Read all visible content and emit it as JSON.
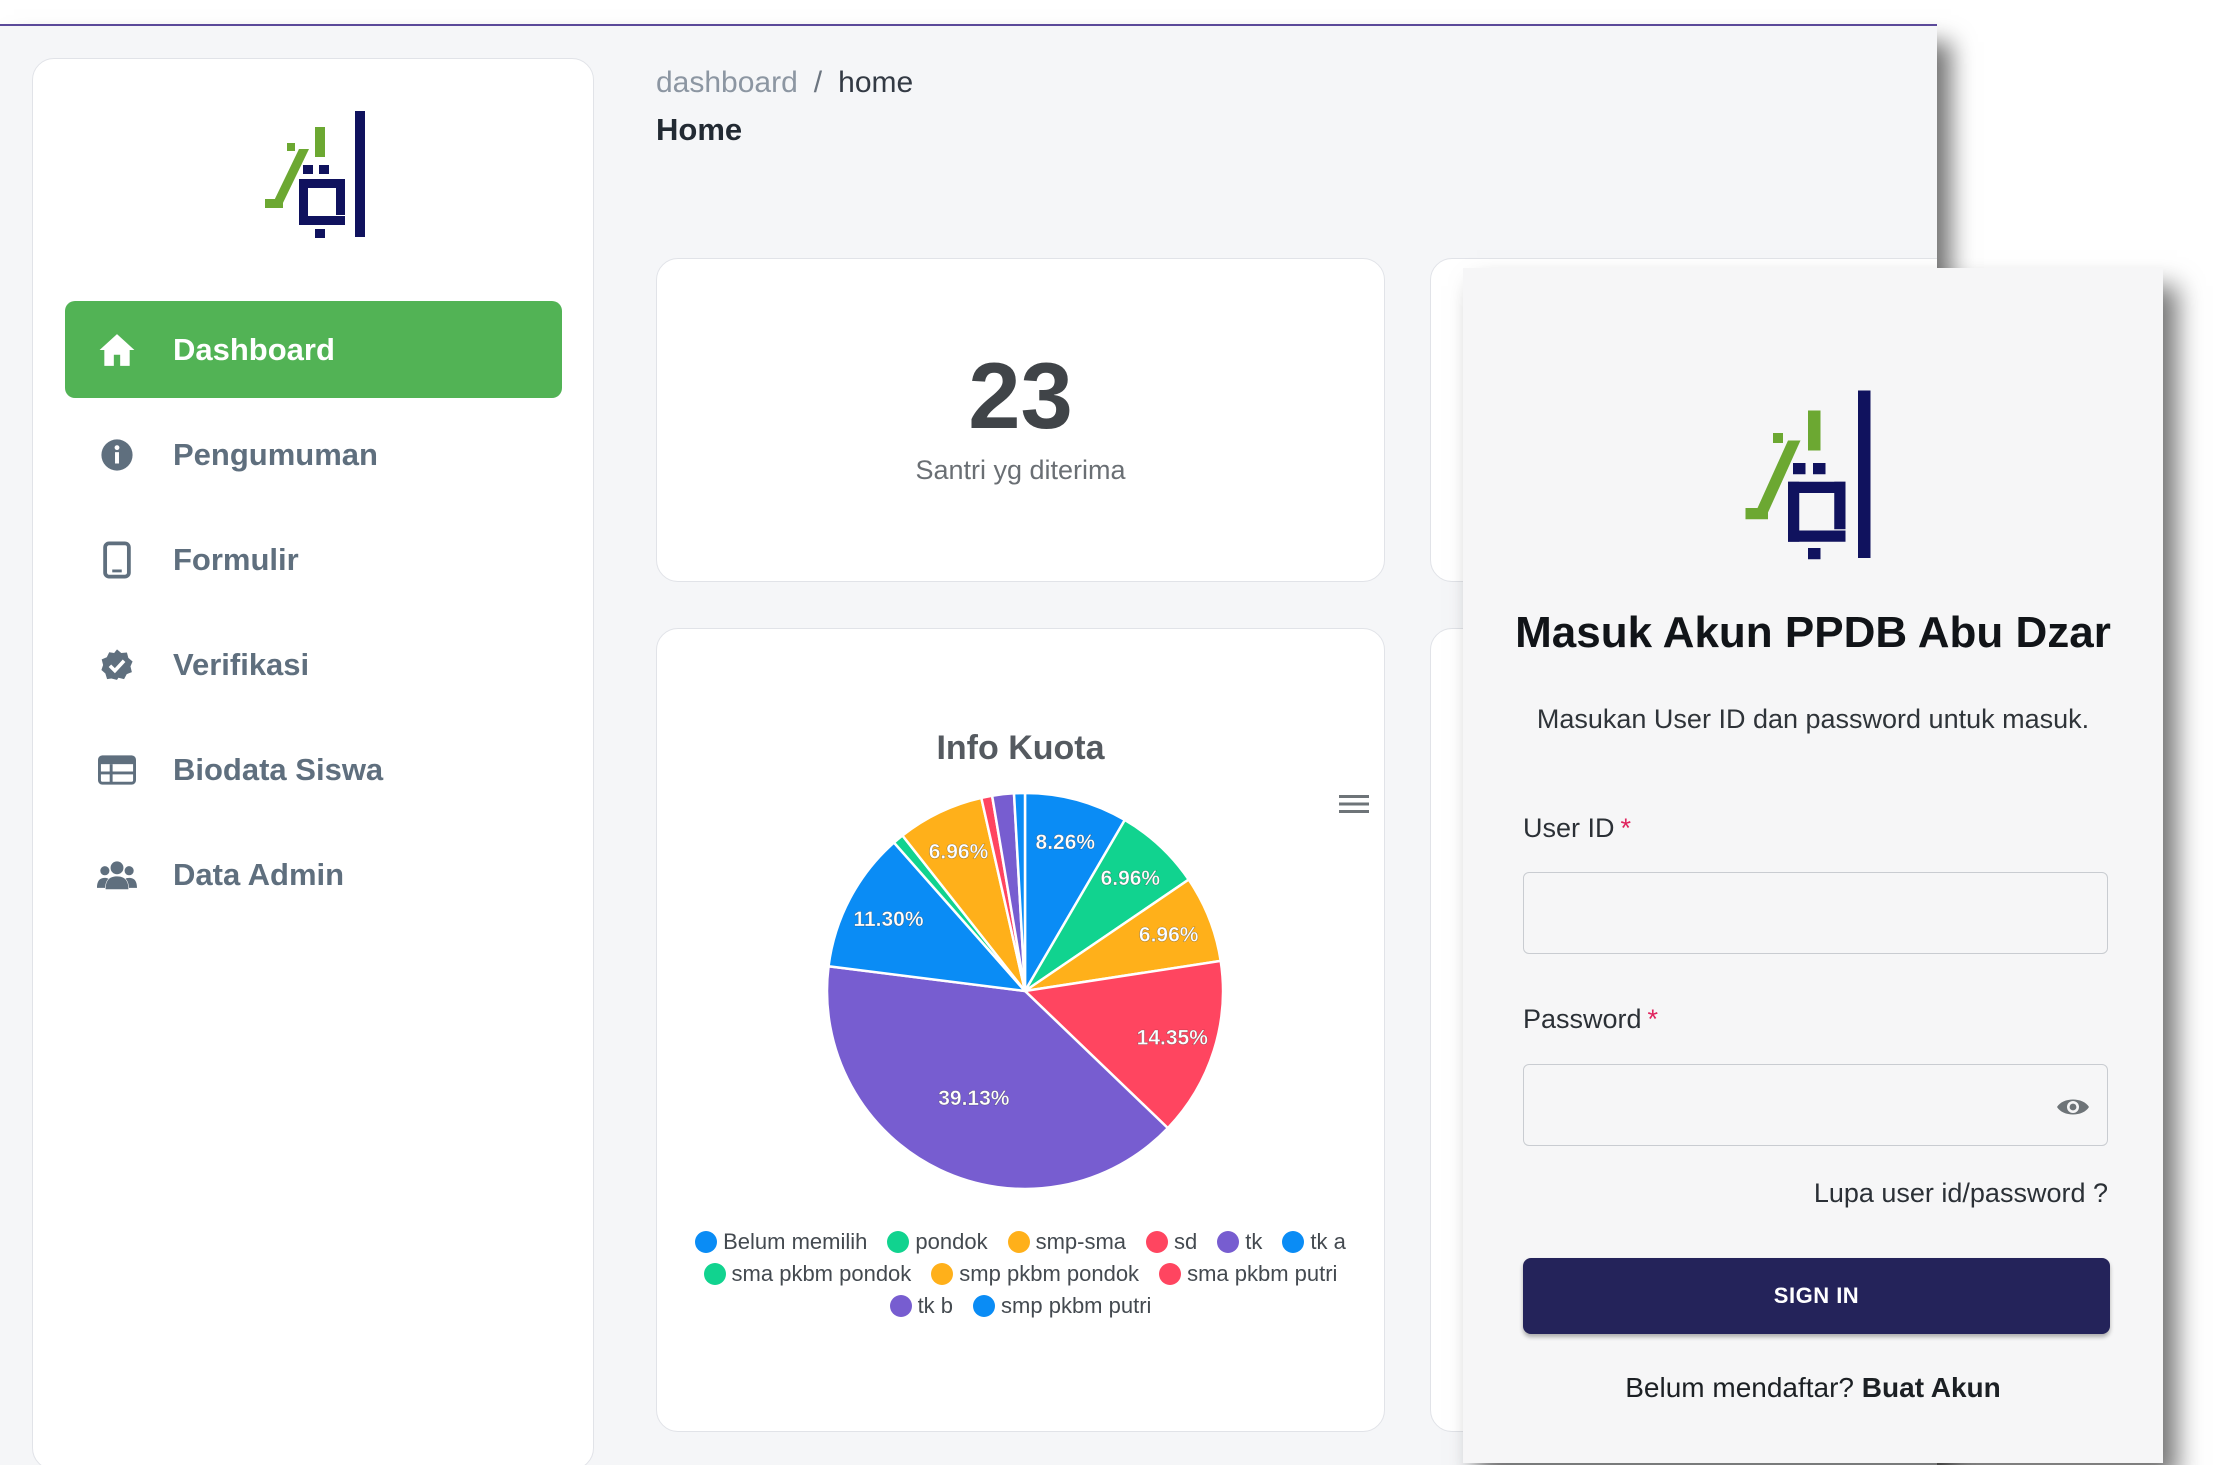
{
  "breadcrumb": {
    "parent": "dashboard",
    "separator": "/",
    "current": "home"
  },
  "page_title": "Home",
  "sidebar": {
    "items": [
      {
        "label": "Dashboard",
        "icon": "home-icon",
        "active": true
      },
      {
        "label": "Pengumuman",
        "icon": "info-icon",
        "active": false
      },
      {
        "label": "Formulir",
        "icon": "tablet-icon",
        "active": false
      },
      {
        "label": "Verifikasi",
        "icon": "verified-badge-icon",
        "active": false
      },
      {
        "label": "Biodata Siswa",
        "icon": "table-icon",
        "active": false
      },
      {
        "label": "Data Admin",
        "icon": "users-icon",
        "active": false
      }
    ]
  },
  "stat": {
    "value": "23",
    "label": "Santri yg diterima"
  },
  "chart_data": {
    "type": "pie",
    "title": "Info Kuota",
    "unit": "%",
    "slices": [
      {
        "name": "Belum memilih",
        "value": 8.26,
        "color": "#0a8cf5",
        "label": "8.26%"
      },
      {
        "name": "pondok",
        "value": 6.96,
        "color": "#11d38f",
        "label": "6.96%"
      },
      {
        "name": "smp-sma",
        "value": 6.96,
        "color": "#ffb01a",
        "label": "6.96%"
      },
      {
        "name": "sd",
        "value": 14.35,
        "color": "#ff4560",
        "label": "14.35%"
      },
      {
        "name": "tk",
        "value": 39.13,
        "color": "#775dd0",
        "label": "39.13%"
      },
      {
        "name": "tk a",
        "value": 11.3,
        "color": "#0a8cf5",
        "label": "11.30%"
      },
      {
        "name": "sma pkbm pondok",
        "value": 0.87,
        "color": "#11d38f",
        "label": ""
      },
      {
        "name": "smp pkbm pondok",
        "value": 6.96,
        "color": "#ffb01a",
        "label": "6.96%"
      },
      {
        "name": "sma pkbm putri",
        "value": 0.87,
        "color": "#ff4560",
        "label": ""
      },
      {
        "name": "tk b",
        "value": 1.74,
        "color": "#775dd0",
        "label": ""
      },
      {
        "name": "smp pkbm putri",
        "value": 0.87,
        "color": "#0a8cf5",
        "label": ""
      }
    ],
    "legend_position": "bottom"
  },
  "login": {
    "title": "Masuk Akun PPDB Abu Dzar",
    "subtitle": "Masukan User ID dan password untuk masuk.",
    "userid_label": "User ID",
    "userid_value": "",
    "password_label": "Password",
    "password_value": "",
    "required_mark": "*",
    "forgot": "Lupa user id/password ?",
    "signin": "SIGN IN",
    "register_prompt": "Belum mendaftar?",
    "register_link": "Buat Akun"
  },
  "colors": {
    "accent_green": "#52b355",
    "signin_button": "#24235a",
    "logo_green": "#6ca832",
    "logo_navy": "#10125e"
  }
}
